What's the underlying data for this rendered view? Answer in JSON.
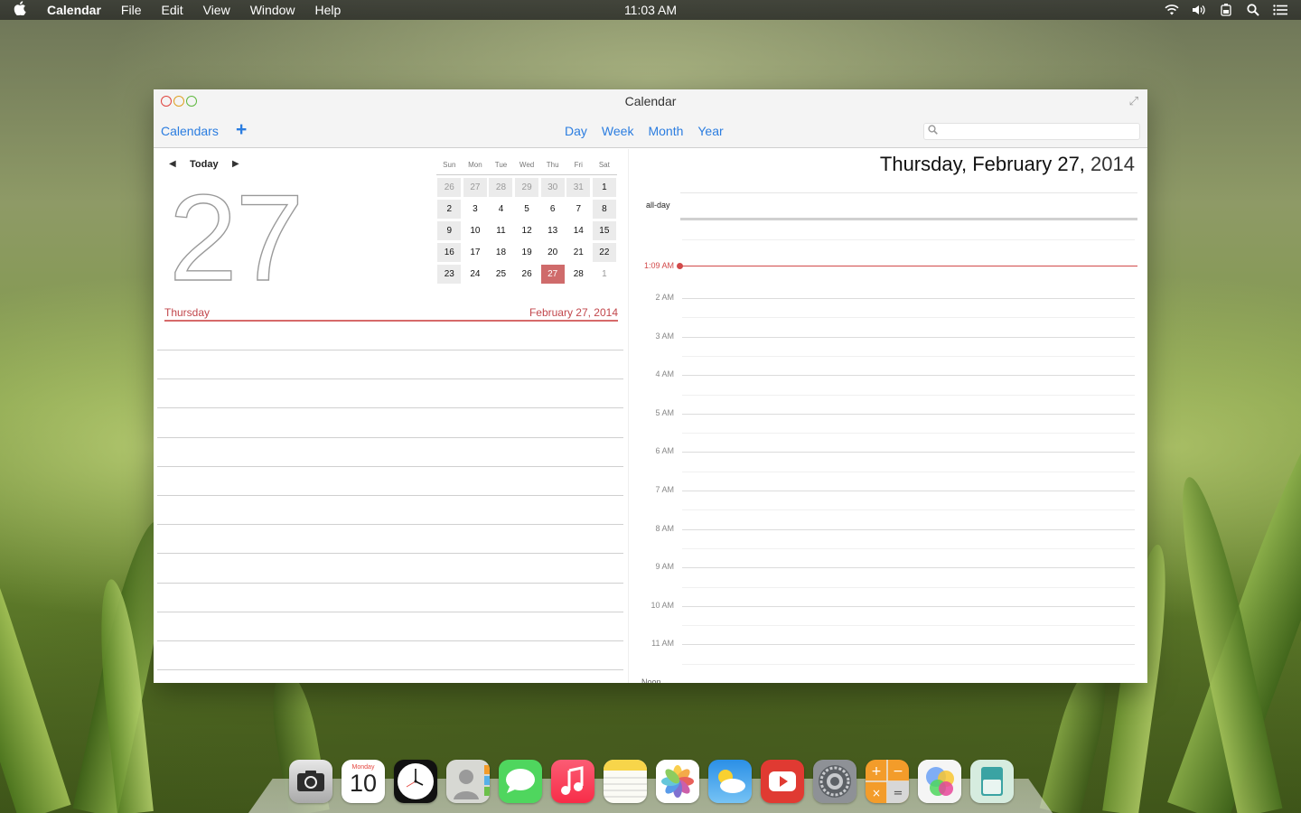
{
  "menubar": {
    "app_name": "Calendar",
    "items": [
      "File",
      "Edit",
      "View",
      "Window",
      "Help"
    ],
    "clock": "11:03 AM"
  },
  "window": {
    "title": "Calendar",
    "toolbar": {
      "calendars_label": "Calendars",
      "add_label": "+",
      "views": [
        "Day",
        "Week",
        "Month",
        "Year"
      ],
      "search_placeholder": ""
    }
  },
  "left_pane": {
    "today_label": "Today",
    "big_day": "27",
    "weekday": "Thursday",
    "full_date": "February 27, 2014",
    "mini_calendar": {
      "days_of_week": [
        "Sun",
        "Mon",
        "Tue",
        "Wed",
        "Thu",
        "Fri",
        "Sat"
      ],
      "weeks": [
        [
          "26",
          "27",
          "28",
          "29",
          "30",
          "31",
          "1"
        ],
        [
          "2",
          "3",
          "4",
          "5",
          "6",
          "7",
          "8"
        ],
        [
          "9",
          "10",
          "11",
          "12",
          "13",
          "14",
          "15"
        ],
        [
          "16",
          "17",
          "18",
          "19",
          "20",
          "21",
          "22"
        ],
        [
          "23",
          "24",
          "25",
          "26",
          "27",
          "28",
          "1"
        ]
      ],
      "selected_day": "27"
    }
  },
  "right_pane": {
    "heading_main": "Thursday, February 27,",
    "heading_year": "2014",
    "allday_label": "all-day",
    "current_time_label": "1:09 AM",
    "hours": [
      "2 AM",
      "3 AM",
      "4 AM",
      "5 AM",
      "6 AM",
      "7 AM",
      "8 AM",
      "9 AM",
      "10 AM",
      "11 AM"
    ],
    "noon_label": "Noon"
  },
  "dock": {
    "apps": [
      "camera-app",
      "calendar-app",
      "clock-app",
      "contacts-app",
      "messages-app",
      "music-app",
      "notes-app",
      "photos-app",
      "weather-app",
      "youtube-app",
      "settings-app",
      "calculator-app",
      "game-center-app",
      "passbook-app"
    ],
    "calendar_icon_weekday": "Monday",
    "calendar_icon_day": "10"
  }
}
